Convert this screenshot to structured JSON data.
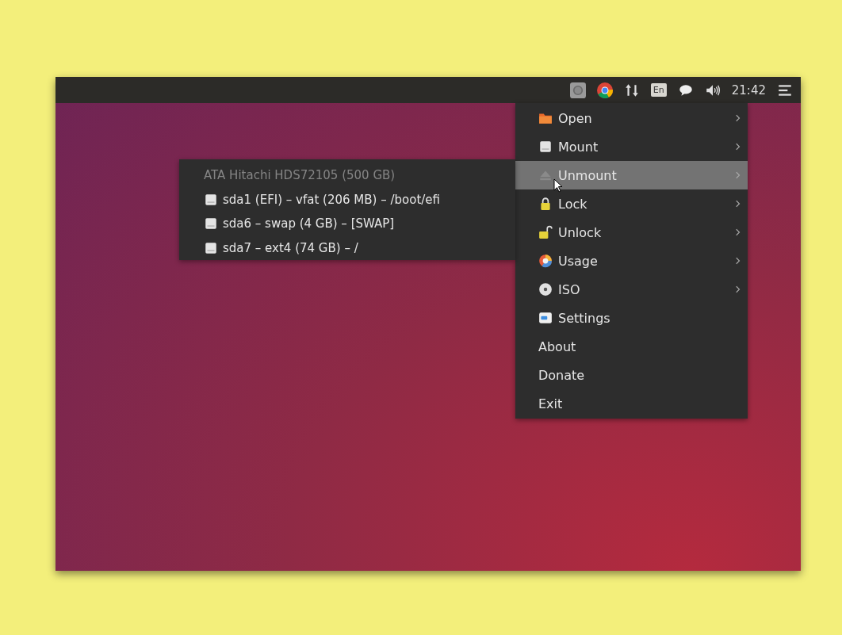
{
  "top_bar": {
    "keyboard_layout": "En",
    "clock": "21:42"
  },
  "menu": {
    "items": [
      {
        "label": "Open",
        "kind": "folder",
        "submenu": true,
        "selected": false
      },
      {
        "label": "Mount",
        "kind": "drive",
        "submenu": true,
        "selected": false
      },
      {
        "label": "Unmount",
        "kind": "eject",
        "submenu": true,
        "selected": true
      },
      {
        "label": "Lock",
        "kind": "lock",
        "submenu": true,
        "selected": false
      },
      {
        "label": "Unlock",
        "kind": "unlock",
        "submenu": true,
        "selected": false
      },
      {
        "label": "Usage",
        "kind": "pie",
        "submenu": true,
        "selected": false
      },
      {
        "label": "ISO",
        "kind": "disc",
        "submenu": true,
        "selected": false
      },
      {
        "label": "Settings",
        "kind": "settings",
        "submenu": false,
        "selected": false
      },
      {
        "label": "About",
        "kind": "text",
        "submenu": false,
        "selected": false
      },
      {
        "label": "Donate",
        "kind": "text",
        "submenu": false,
        "selected": false
      },
      {
        "label": "Exit",
        "kind": "text",
        "submenu": false,
        "selected": false
      }
    ]
  },
  "submenu": {
    "items": [
      {
        "label": "ATA Hitachi HDS72105 (500 GB)",
        "kind": "header",
        "disabled": true
      },
      {
        "label": "sda1 (EFI) – vfat (206 MB) – /boot/efi",
        "kind": "drive",
        "disabled": false
      },
      {
        "label": "sda6 – swap (4 GB) – [SWAP]",
        "kind": "drive",
        "disabled": false
      },
      {
        "label": "sda7 – ext4 (74 GB) – /",
        "kind": "drive",
        "disabled": false
      }
    ]
  }
}
